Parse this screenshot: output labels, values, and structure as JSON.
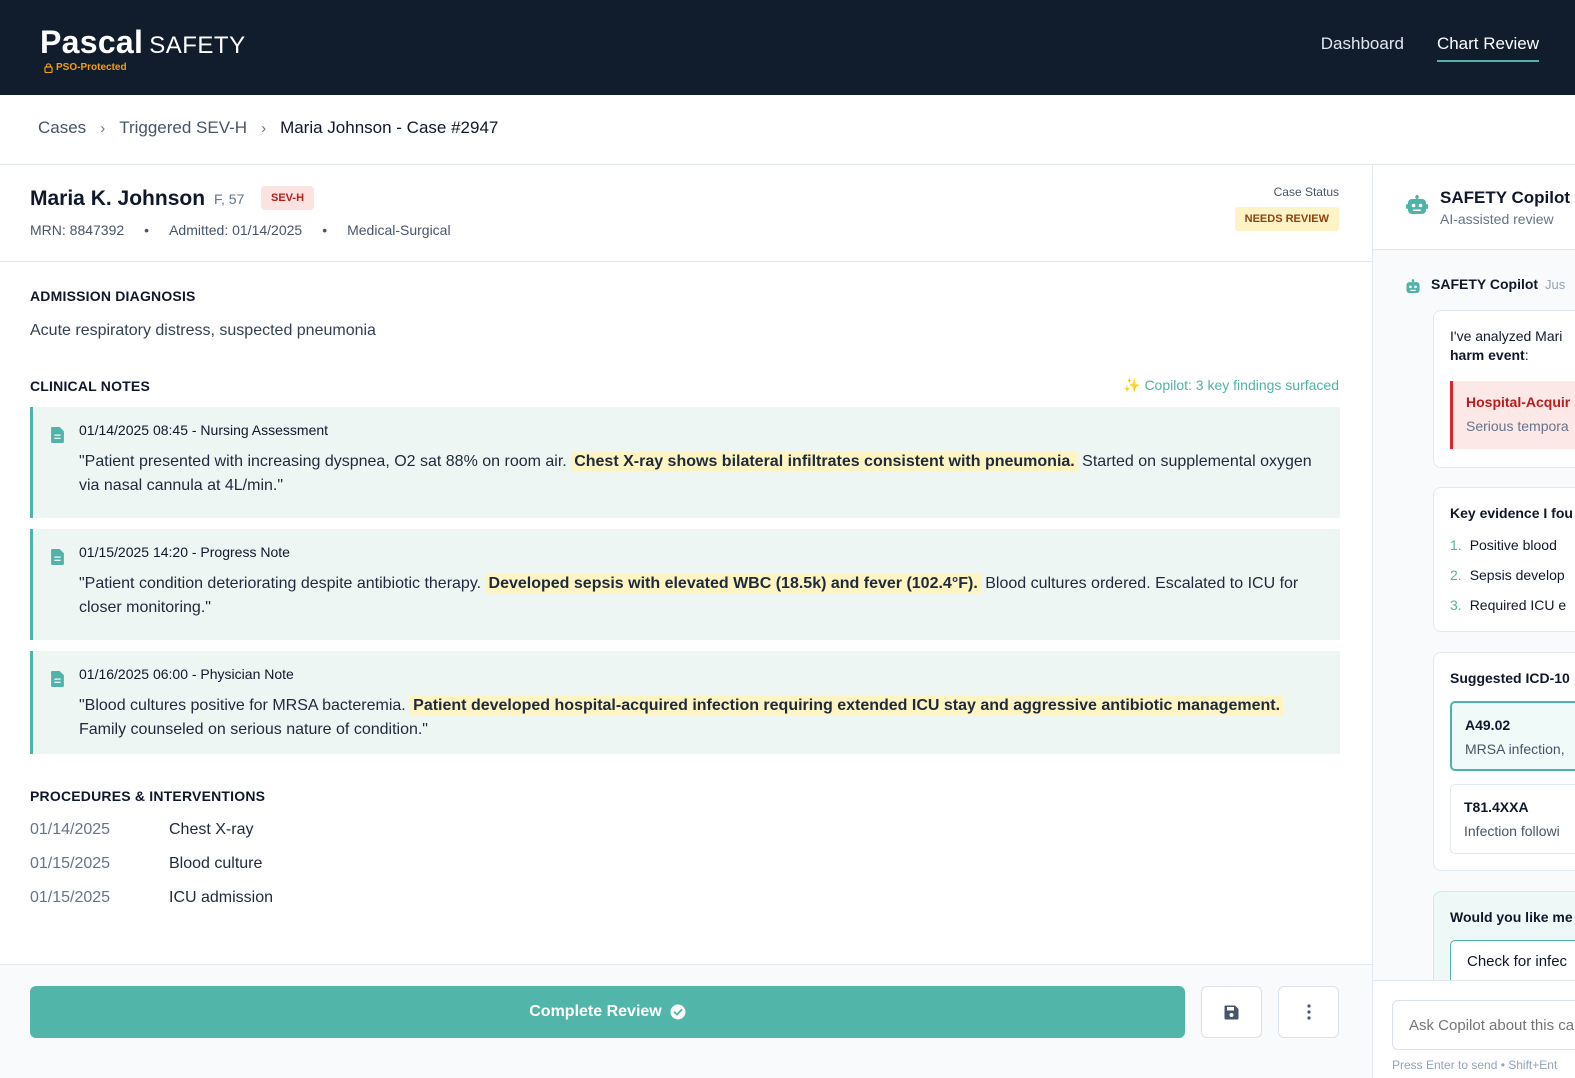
{
  "header": {
    "logo_main": "Pascal",
    "logo_sub": "SAFETY",
    "pso_label": "PSO-Protected",
    "nav": [
      {
        "label": "Dashboard",
        "active": false
      },
      {
        "label": "Chart Review",
        "active": true
      }
    ]
  },
  "breadcrumb": [
    "Cases",
    "Triggered SEV-H",
    "Maria Johnson - Case #2947"
  ],
  "patient": {
    "name": "Maria K. Johnson",
    "demographics": "F, 57",
    "severity": "SEV-H",
    "mrn": "MRN: 8847392",
    "admitted": "Admitted: 01/14/2025",
    "unit": "Medical-Surgical",
    "case_status_label": "Case Status",
    "case_status": "NEEDS REVIEW"
  },
  "admission": {
    "title": "ADMISSION DIAGNOSIS",
    "text": "Acute respiratory distress, suspected pneumonia"
  },
  "clinical_notes": {
    "title": "CLINICAL NOTES",
    "copilot_badge": "✨ Copilot: 3 key findings surfaced",
    "notes": [
      {
        "title": "01/14/2025 08:45 - Nursing Assessment",
        "before": "\"Patient presented with increasing dyspnea, O2 sat 88% on room air. ",
        "highlight": "Chest X-ray shows bilateral infiltrates consistent with pneumonia.",
        "after": " Started on supplemental oxygen via nasal cannula at 4L/min.\""
      },
      {
        "title": "01/15/2025 14:20 - Progress Note",
        "before": "\"Patient condition deteriorating despite antibiotic therapy. ",
        "highlight": "Developed sepsis with elevated WBC (18.5k) and fever (102.4°F).",
        "after": " Blood cultures ordered. Escalated to ICU for closer monitoring.\""
      },
      {
        "title": "01/16/2025 06:00 - Physician Note",
        "before": "\"Blood cultures positive for MRSA bacteremia. ",
        "highlight": "Patient developed hospital-acquired infection requiring extended ICU stay and aggressive antibiotic management.",
        "after": " Family counseled on serious nature of condition.\""
      }
    ]
  },
  "procedures": {
    "title": "PROCEDURES & INTERVENTIONS",
    "rows": [
      {
        "date": "01/14/2025",
        "name": "Chest X-ray"
      },
      {
        "date": "01/15/2025",
        "name": "Blood culture"
      },
      {
        "date": "01/15/2025",
        "name": "ICU admission"
      }
    ]
  },
  "footer": {
    "complete_label": "Complete Review"
  },
  "copilot": {
    "title": "SAFETY Copilot",
    "subtitle": "AI-assisted review",
    "msg_author": "SAFETY Copilot",
    "msg_time": "Jus",
    "intro_line1": "I've analyzed Mari",
    "intro_bold": "harm event",
    "intro_colon": ":",
    "harm_title": "Hospital-Acquir",
    "harm_desc": "Serious tempora",
    "evidence_title": "Key evidence I fou",
    "evidence": [
      {
        "num": "1.",
        "text": "Positive blood"
      },
      {
        "num": "2.",
        "text": "Sepsis develop"
      },
      {
        "num": "3.",
        "text": "Required ICU e"
      }
    ],
    "icd_title": "Suggested ICD-10",
    "icd": [
      {
        "code": "A49.02",
        "desc": "MRSA infection,",
        "selected": true
      },
      {
        "code": "T81.4XXA",
        "desc": "Infection followi",
        "selected": false
      }
    ],
    "followup_title": "Would you like me",
    "followup_button": "Check for infec",
    "input_placeholder": "Ask Copilot about this ca",
    "hint": "Press Enter to send • Shift+Ent"
  },
  "colors": {
    "header_bg": "#111c2d",
    "accent": "#4fb3a9",
    "highlight": "#fdf4c4",
    "danger": "#dc2626",
    "warning_bg": "#fef3c7"
  }
}
